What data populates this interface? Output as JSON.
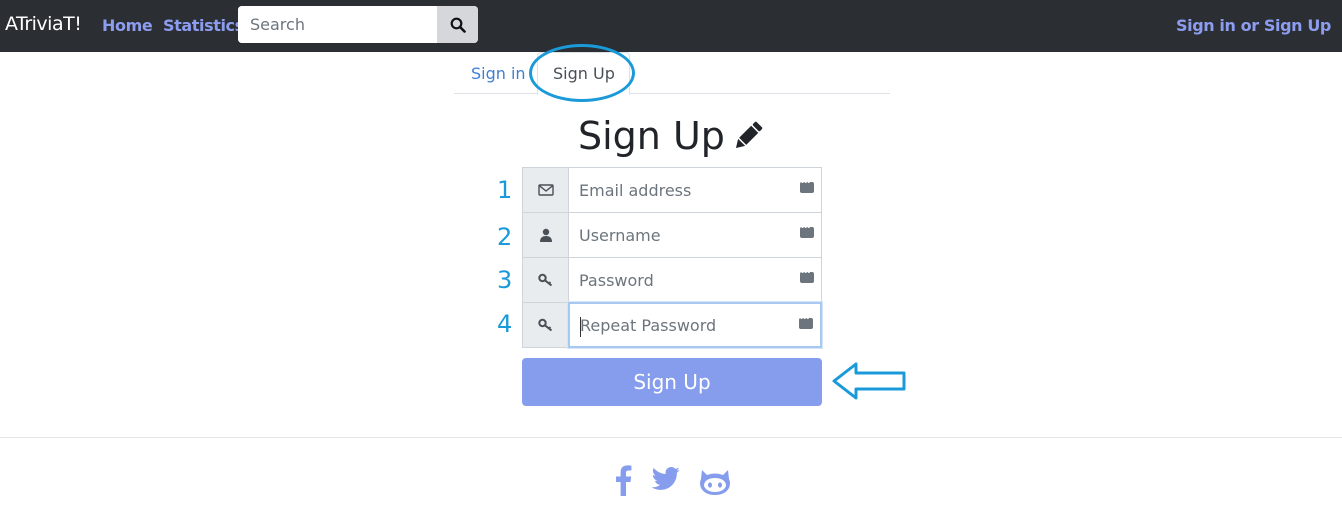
{
  "navbar": {
    "brand": "ATriviaT!",
    "home": "Home",
    "statistics": "Statistics",
    "search_placeholder": "Search",
    "signin": "Sign in or Sign Up"
  },
  "tabs": {
    "signin": "Sign in",
    "signup": "Sign Up",
    "active": "Sign Up"
  },
  "title": "Sign Up",
  "form": {
    "fields": [
      {
        "num": "1",
        "placeholder": "Email address",
        "icon": "envelope-icon"
      },
      {
        "num": "2",
        "placeholder": "Username",
        "icon": "user-icon"
      },
      {
        "num": "3",
        "placeholder": "Password",
        "icon": "key-icon"
      },
      {
        "num": "4",
        "placeholder": "Repeat Password",
        "icon": "key-icon"
      }
    ],
    "submit": "Sign Up"
  },
  "footer": {
    "icons": [
      "facebook-icon",
      "twitter-icon",
      "github-icon"
    ]
  },
  "colors": {
    "navbar_bg": "#2b2e33",
    "nav_link": "#8c9df0",
    "button": "#869cec",
    "annotation": "#1a9ad8"
  }
}
